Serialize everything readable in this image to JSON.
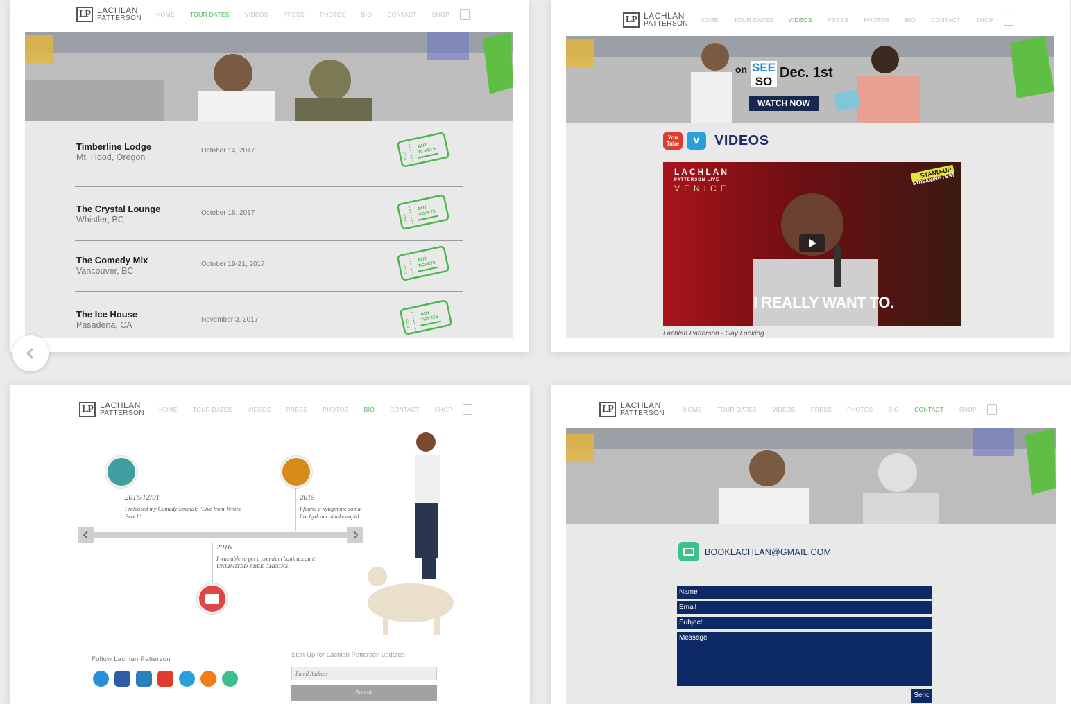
{
  "site": {
    "logo_mark": "LP",
    "logo_line1": "LACHLAN",
    "logo_line2": "PATTERSON",
    "nav": [
      "HOME",
      "TOUR DATES",
      "VIDEOS",
      "PRESS",
      "PHOTOS",
      "BIO",
      "CONTACT",
      "SHOP"
    ]
  },
  "colors": {
    "accent_green": "#49b74d",
    "form_navy": "#0e2a66",
    "panel_gray": "#e9e9e9"
  },
  "tour_dates": {
    "active_nav": "TOUR DATES",
    "ticket_label_1": "BUY",
    "ticket_label_2": "TICKETS",
    "ticket_stub": "10/15",
    "rows": [
      {
        "venue": "Timberline Lodge",
        "location": "Mt. Hood, Oregon",
        "date": "October 14, 2017"
      },
      {
        "venue": "The Crystal Lounge",
        "location": "Whistler, BC",
        "date": "October 18, 2017"
      },
      {
        "venue": "The Comedy Mix",
        "location": "Vancouver, BC",
        "date": "October 19-21, 2017"
      },
      {
        "venue": "The Ice House",
        "location": "Pasadena, CA",
        "date": "November 3, 2017"
      }
    ]
  },
  "videos": {
    "active_nav": "VIDEOS",
    "banner_on": "on",
    "banner_brand_1": "SEE",
    "banner_brand_2": "SO",
    "banner_date": "Dec. 1st",
    "banner_cta": "WATCH NOW",
    "heading": "VIDEOS",
    "youtube_label": "You Tube",
    "video_title_overlay_1": "LACHLAN",
    "video_title_overlay_2": "PATTERSON LIVE",
    "video_title_overlay_3": "VENICE",
    "video_badge_1": "STAND-UP",
    "video_badge_2": "STREAMING FEST",
    "video_subtitle": "I REALLY WANT TO.",
    "video_caption": "Lachlan Patterson - Gay Looking"
  },
  "bio": {
    "active_nav": "BIO",
    "events": [
      {
        "date": "2016/12/01",
        "text": "I released my Comedy Special: \"Live from Venice Beach\""
      },
      {
        "date": "2015",
        "text": "I found a xylophone soma fire hydrant. #dukestupid"
      },
      {
        "date": "2016",
        "text": "I was able to get a premium bank account. UNLIMITED FREE CHECKS!"
      }
    ],
    "follow_label": "Follow Lachlan Patterson",
    "signup_label": "Sign-Up for Lachlan Patterson updates",
    "email_placeholder": "Email Address",
    "submit_label": "Submit"
  },
  "contact": {
    "active_nav": "CONTACT",
    "email": "BOOKLACHLAN@GMAIL.COM",
    "fields": [
      "Name",
      "Email",
      "Subject",
      "Message"
    ],
    "send_label": "Send"
  }
}
